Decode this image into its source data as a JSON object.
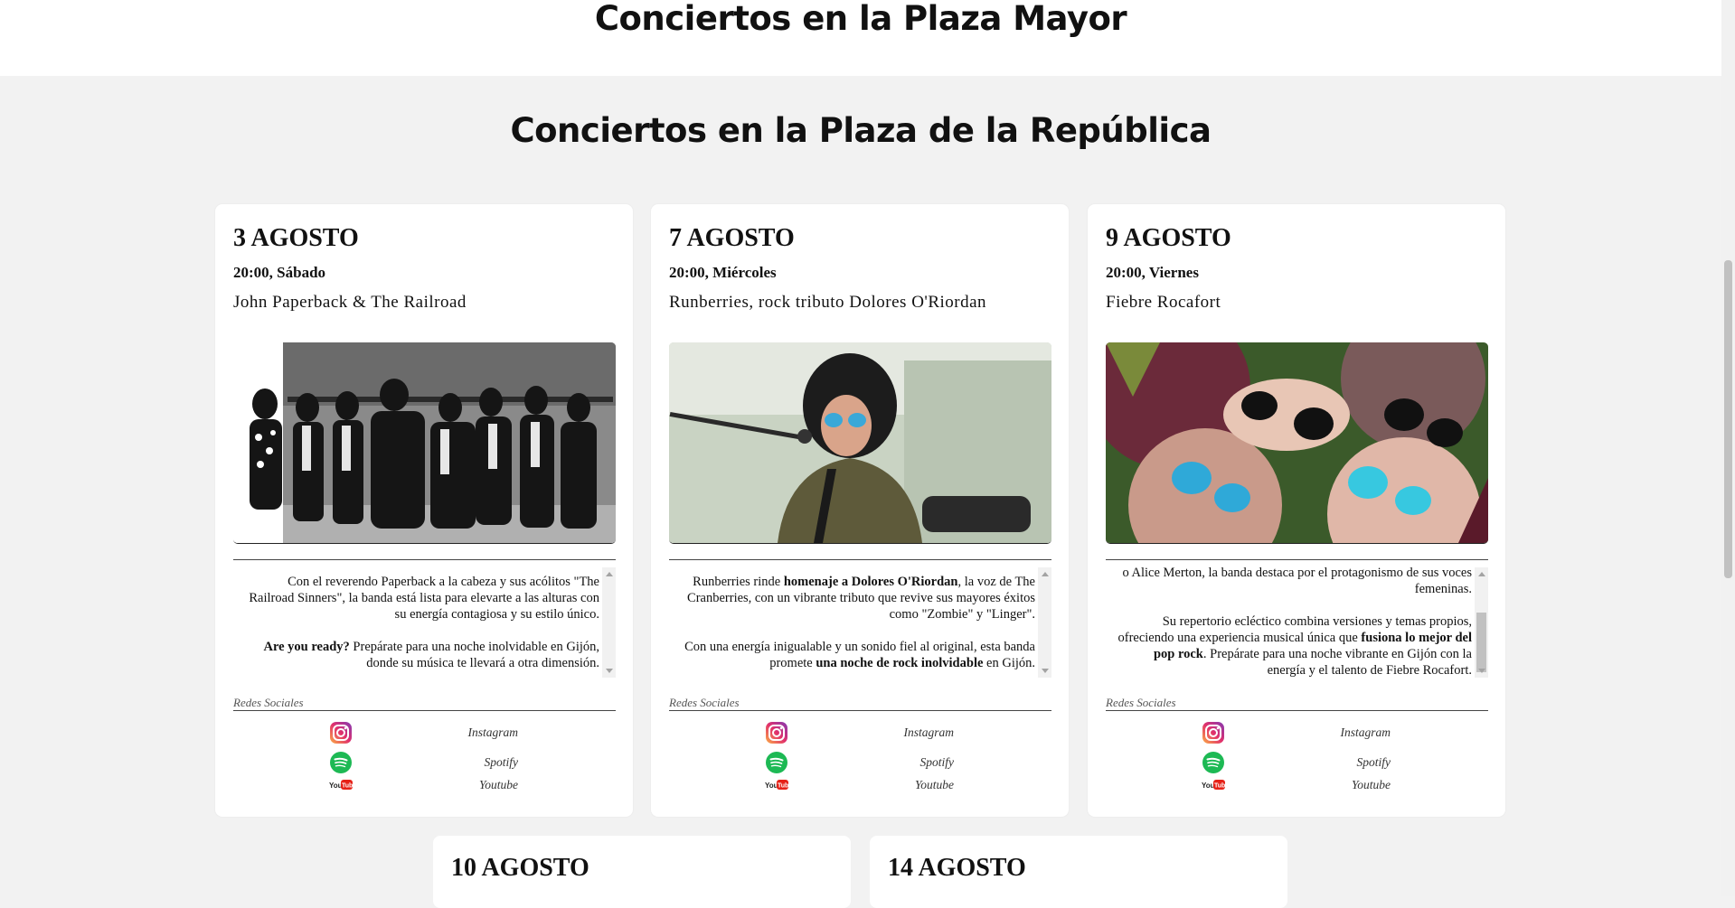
{
  "headings": {
    "plaza_mayor": "Conciertos en la Plaza Mayor",
    "plaza_republica": "Conciertos en la Plaza de la República"
  },
  "cards": [
    {
      "date": "3 AGOSTO",
      "time": "20:00, Sábado",
      "artist": "John Paperback & The Railroad",
      "desc": [
        [
          {
            "t": "Con el reverendo Paperback a la cabeza y sus acólitos \"The Railroad Sinners\", la banda está lista para elevarte a las alturas con su energía contagiosa y su estilo único.",
            "b": false
          }
        ],
        [
          {
            "t": "Are you ready?",
            "b": true
          },
          {
            "t": " Prepárate para una noche inolvidable en Gijón, donde su música te llevará a otra dimensión.",
            "b": false
          }
        ]
      ],
      "social_heading": "Redes Sociales",
      "social": [
        "Instagram",
        "Spotify",
        "Youtube"
      ]
    },
    {
      "date": "7 AGOSTO",
      "time": "20:00, Miércoles",
      "artist": "Runberries, rock tributo Dolores O'Riordan",
      "desc": [
        [
          {
            "t": "Runberries rinde ",
            "b": false
          },
          {
            "t": "homenaje a Dolores O'Riordan",
            "b": true
          },
          {
            "t": ", la voz de The Cranberries, con un vibrante tributo que revive sus mayores éxitos como \"Zombie\" y \"Linger\".",
            "b": false
          }
        ],
        [
          {
            "t": "Con una energía inigualable y un sonido fiel al original, esta banda promete ",
            "b": false
          },
          {
            "t": "una noche de rock inolvidable",
            "b": true
          },
          {
            "t": " en Gijón.",
            "b": false
          }
        ]
      ],
      "social_heading": "Redes Sociales",
      "social": [
        "Instagram",
        "Spotify",
        "Youtube"
      ]
    },
    {
      "date": "9 AGOSTO",
      "time": "20:00, Viernes",
      "artist": "Fiebre Rocafort",
      "desc": [
        [
          {
            "t": "o Alice Merton, la banda destaca por el protagonismo de sus voces femeninas.",
            "b": false
          }
        ],
        [
          {
            "t": "Su repertorio ecléctico combina versiones y temas propios, ofreciendo una experiencia musical única que ",
            "b": false
          },
          {
            "t": "fusiona lo mejor del pop rock",
            "b": true
          },
          {
            "t": ". Prepárate para una noche vibrante en Gijón con la energía y el talento de Fiebre Rocafort.",
            "b": false
          }
        ]
      ],
      "social_heading": "Redes Sociales",
      "social": [
        "Instagram",
        "Spotify",
        "Youtube"
      ]
    }
  ],
  "next_cards": [
    {
      "date": "10 AGOSTO"
    },
    {
      "date": "14 AGOSTO"
    }
  ],
  "icons": {
    "instagram": "instagram-icon",
    "spotify": "spotify-icon",
    "youtube": "youtube-icon"
  },
  "colors": {
    "spotify_green": "#1db954",
    "youtube_red": "#e62117",
    "page_bg": "#f2f2f2"
  }
}
